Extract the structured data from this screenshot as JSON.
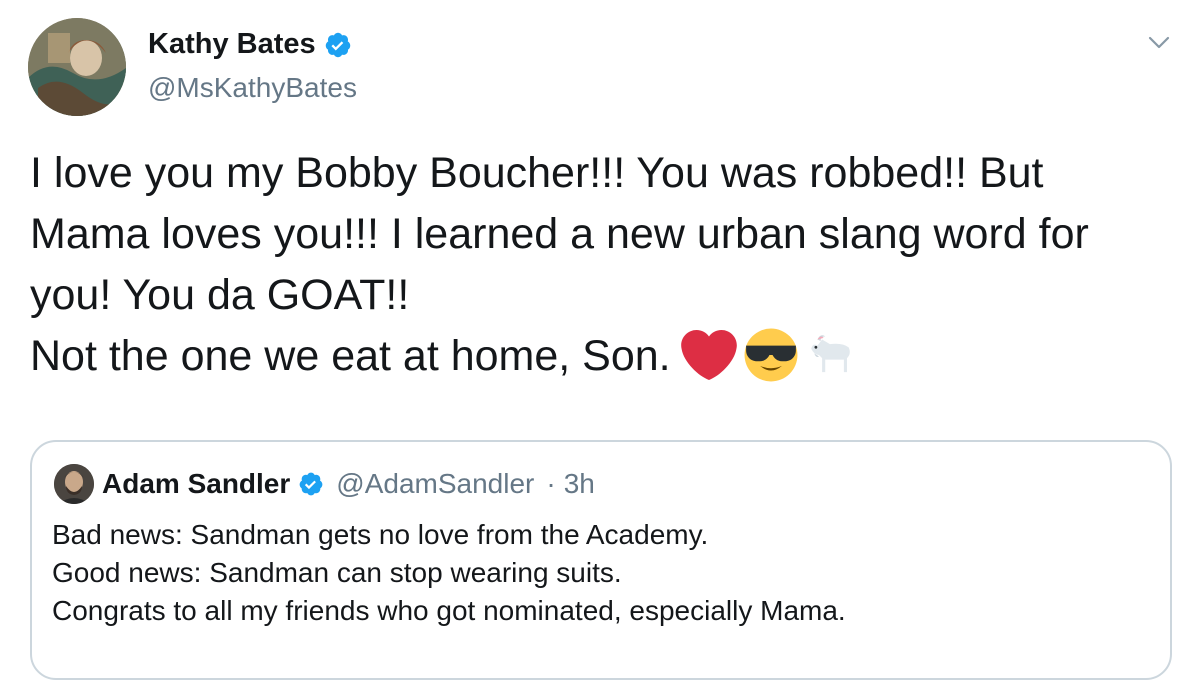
{
  "tweet": {
    "author_name": "Kathy Bates",
    "author_handle": "@MsKathyBates",
    "lines": [
      "I love you my Bobby Boucher!!! You was robbed!! But",
      "Mama loves you!!! I learned a new urban slang word for",
      "you! You da GOAT!!",
      "Not the one we eat at home, Son."
    ],
    "emojis": [
      "red-heart-emoji",
      "sunglasses-face-emoji",
      "goat-emoji"
    ]
  },
  "quoted_tweet": {
    "author_name": "Adam Sandler",
    "author_handle": "@AdamSandler",
    "separator": "·",
    "time": "3h",
    "lines": [
      "Bad news: Sandman gets no love from the Academy.",
      "Good news: Sandman can stop wearing suits.",
      "Congrats to all my friends who got nominated, especially Mama."
    ]
  },
  "colors": {
    "verified_blue": "#1da1f2",
    "secondary_text": "#657786",
    "border": "#ccd6dd"
  }
}
